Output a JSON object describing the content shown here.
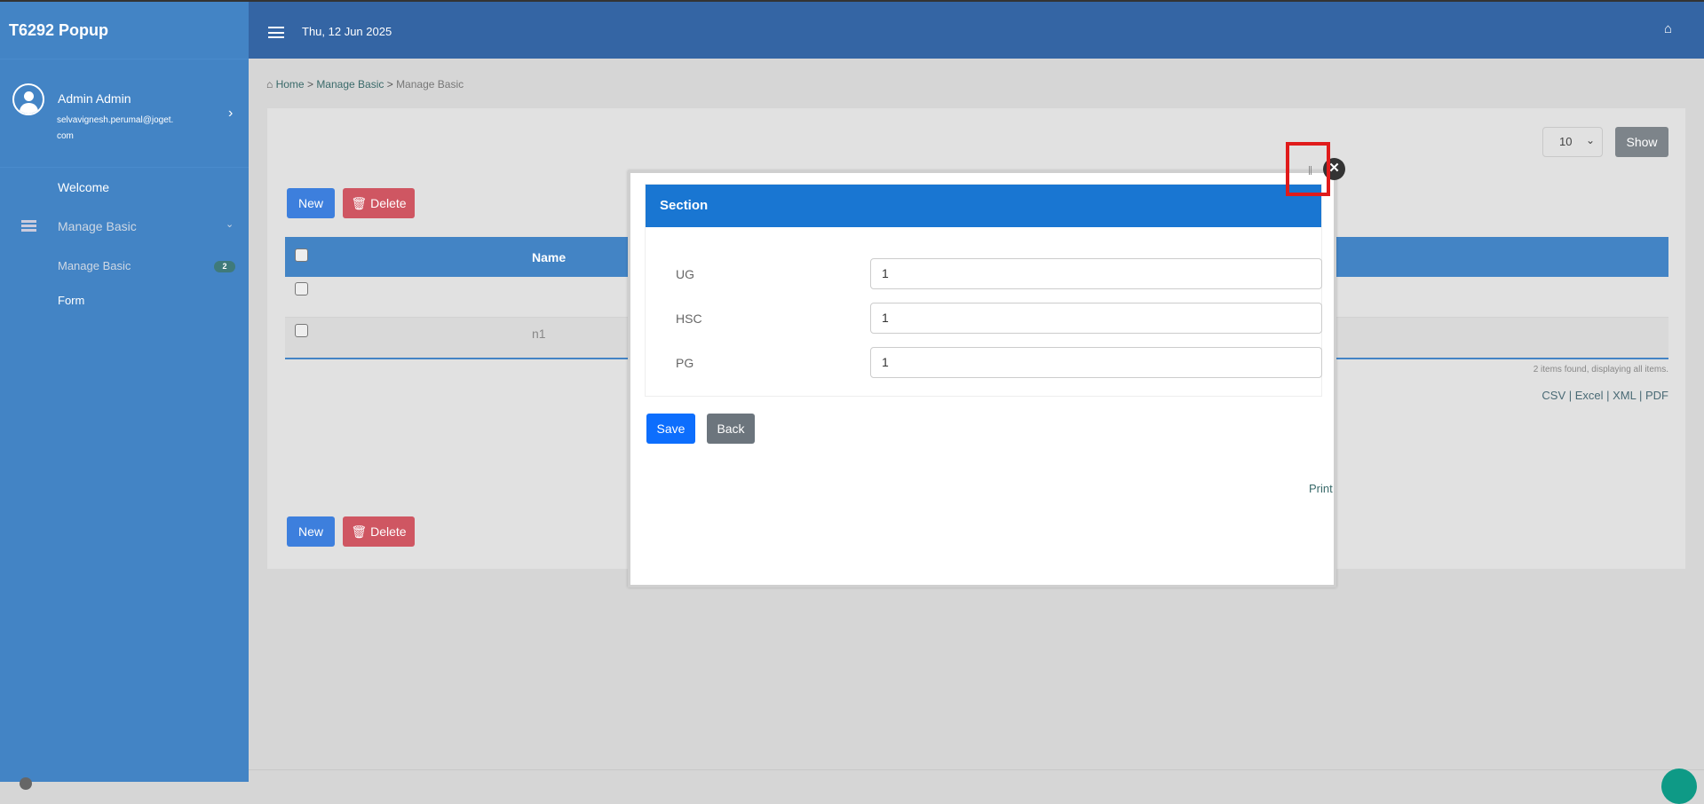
{
  "app": {
    "title": "T6292 Popup",
    "date": "Thu, 12 Jun 2025"
  },
  "profile": {
    "name": "Admin Admin",
    "email_line1": "selvavignesh.perumal@joget.",
    "email_line2": "com"
  },
  "sidebar": {
    "items": [
      {
        "label": "Welcome"
      },
      {
        "label": "Manage Basic"
      },
      {
        "label": "Manage Basic",
        "badge": "2"
      },
      {
        "label": "Form"
      }
    ]
  },
  "breadcrumb": {
    "home": "Home",
    "sep": ">",
    "item1": "Manage Basic",
    "item2": "Manage Basic"
  },
  "list": {
    "page_size": "10",
    "show_label": "Show",
    "new_label": "New",
    "delete_label": "Delete",
    "columns": [
      "Name"
    ],
    "rows": [
      {
        "name": ""
      },
      {
        "name": "n1"
      }
    ],
    "summary": "2 items found, displaying all items.",
    "exports": [
      "CSV",
      "Excel",
      "XML",
      "PDF"
    ]
  },
  "popup": {
    "section_title": "Section",
    "fields": [
      {
        "label": "UG",
        "value": "1"
      },
      {
        "label": "HSC",
        "value": "1"
      },
      {
        "label": "PG",
        "value": "1"
      }
    ],
    "save_label": "Save",
    "back_label": "Back",
    "print_label": "Print"
  },
  "colors": {
    "sidebar": "#4384c5",
    "header": "#3465a4",
    "section": "#1976d2",
    "save": "#0d6efd",
    "back": "#6c757d",
    "highlight": "#e01b1b"
  }
}
